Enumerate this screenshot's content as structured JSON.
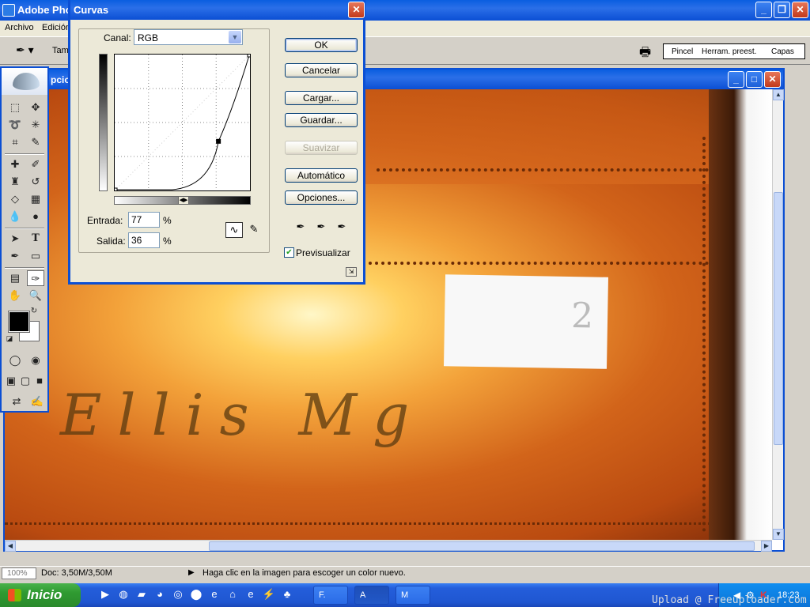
{
  "app": {
    "title": "Adobe Photoshop",
    "title_visible": "Adobe Pho",
    "menu": [
      "Archivo",
      "Edición"
    ]
  },
  "options_bar": {
    "label_tam": "Tam",
    "palette_tabs": [
      "Pincel",
      "Herram. preest.",
      "Capas"
    ]
  },
  "document": {
    "title_fragment": "pcio",
    "label_number": "2",
    "writing": "Ellis Mg"
  },
  "tools": {
    "items": [
      "marquee-icon",
      "move-icon",
      "lasso-icon",
      "magic-wand-icon",
      "crop-icon",
      "slice-icon",
      "healing-icon",
      "brush-icon",
      "stamp-icon",
      "history-brush-icon",
      "eraser-icon",
      "gradient-icon",
      "blur-icon",
      "dodge-icon",
      "path-select-icon",
      "type-icon",
      "pen-icon",
      "shape-icon",
      "notes-icon",
      "eyedropper-icon",
      "hand-icon",
      "zoom-icon"
    ],
    "type_glyph": "T",
    "foreground_color": "#000000",
    "background_color": "#ffffff"
  },
  "curves_dialog": {
    "title": "Curvas",
    "canal_label": "Canal:",
    "canal_value": "RGB",
    "entrada_label": "Entrada:",
    "entrada_value": "77",
    "salida_label": "Salida:",
    "salida_value": "36",
    "percent": "%",
    "buttons": {
      "ok": "OK",
      "cancelar": "Cancelar",
      "cargar": "Cargar...",
      "guardar": "Guardar...",
      "suavizar": "Suavizar",
      "automatico": "Automático",
      "opciones": "Opciones..."
    },
    "previsualizar_label": "Previsualizar",
    "previsualizar_checked": true,
    "curve_points": [
      [
        0,
        0
      ],
      [
        77,
        36
      ],
      [
        100,
        100
      ]
    ]
  },
  "status": {
    "zoom": "100%",
    "doc": "Doc: 3,50M/3,50M",
    "hint": "Haga clic en la imagen para escoger un color nuevo."
  },
  "taskbar": {
    "start": "Inicio",
    "tasks": [
      "F.",
      "A",
      "M"
    ],
    "clock": "18:23"
  },
  "watermark": "Upload @ Freeuploader.com"
}
